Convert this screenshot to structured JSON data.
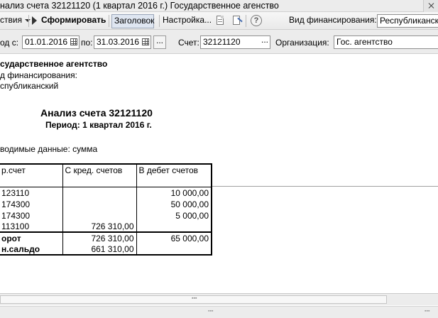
{
  "window": {
    "title": "нализ счета 32121120 (1 квартал 2016 г.) Государственное агенство"
  },
  "toolbar": {
    "actions_label": "ствия",
    "generate_label": "Сформировать",
    "header_label": "Заголовок",
    "settings_label": "Настройка...",
    "help_label": "?",
    "financing_label": "Вид финансирования:",
    "financing_value": "Республиканский"
  },
  "filter": {
    "period_from_label": "од с:",
    "period_from_value": "01.01.2016",
    "period_to_label": "по:",
    "period_to_value": "31.03.2016",
    "dots_label": "...",
    "account_label": "Счет:",
    "account_value": "32121120",
    "account_dots": "...",
    "org_label": "Организация:",
    "org_value": "Гос. агентство"
  },
  "report": {
    "org_name": "сударственное агентство",
    "financing_line": "д финансирования:",
    "financing_value": "спубликанский",
    "title": "Анализ счета 32121120",
    "period": "Период: 1 квартал 2016 г.",
    "data_shown": "водимые данные: сумма",
    "table": {
      "headers": [
        "р.счет",
        "С кред. счетов",
        "В дебет счетов"
      ],
      "rows": [
        {
          "account": "123110",
          "credit": "",
          "debit": "10 000,00"
        },
        {
          "account": "174300",
          "credit": "",
          "debit": "50 000,00"
        },
        {
          "account": "174300",
          "credit": "",
          "debit": "5 000,00"
        },
        {
          "account": "113100",
          "credit": "726 310,00",
          "debit": ""
        }
      ],
      "turnover": {
        "label": "орот",
        "credit": "726 310,00",
        "debit": "65 000,00"
      },
      "balance": {
        "label": "н.сальдо",
        "credit": "661 310,00",
        "debit": ""
      }
    }
  }
}
